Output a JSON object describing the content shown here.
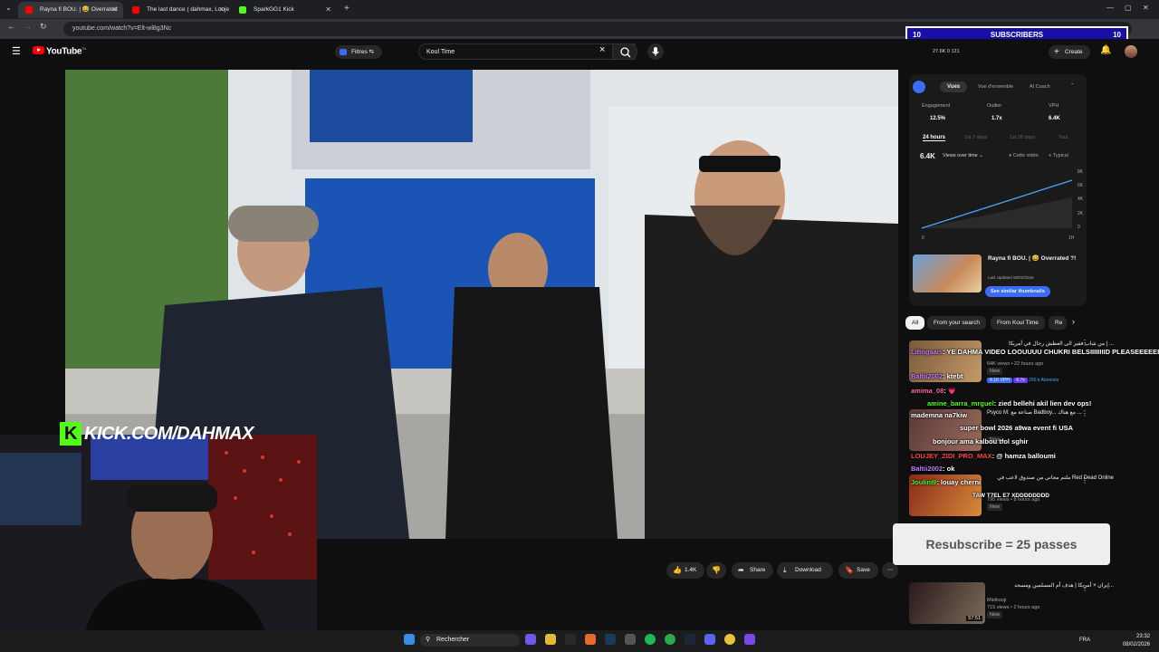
{
  "browser": {
    "tabs": [
      {
        "title": "Rayna fi BOU. | 😅 Overrated",
        "favicon_color": "#ff0000"
      },
      {
        "title": "The last dance ( dahmax, Louje",
        "favicon_color": "#ff0000"
      },
      {
        "title": "SparkGG1 Kick",
        "favicon_color": "#53fc18"
      }
    ],
    "new_tab": "+",
    "url": "youtube.com/watch?v=Elt-wl8g3Nc"
  },
  "youtube": {
    "logo": "YouTube",
    "logo_sup": "TN",
    "filter_label": "Filtres",
    "search_value": "Koul Time",
    "clear_icon": "×",
    "stats": "27.6K  0  121",
    "create_label": "Create"
  },
  "stream": {
    "kick_text": "KICK.COM/DAHMAX",
    "sub_counter": {
      "left": "10",
      "label": "SUBSCRIBERS",
      "right": "10"
    },
    "resub_text": "Resubscribe = 25 passes"
  },
  "actions": {
    "likes": "1.4K",
    "share": "Share",
    "download": "Download",
    "save": "Save"
  },
  "vidiq": {
    "tabs": [
      "Vues",
      "Vue d'ensemble",
      "AI Coach"
    ],
    "metrics": [
      {
        "label": "Engagement",
        "value": "12.5%"
      },
      {
        "label": "Outlier",
        "value": "1.7x"
      },
      {
        "label": "VPH",
        "value": "6.4K"
      }
    ],
    "ranges": [
      "24 hours",
      "1st 7 days",
      "1st 28 days",
      "Tout"
    ],
    "views_value": "6.4K",
    "views_label": "Views over time",
    "legend_this": "Cette vidéo",
    "legend_typical": "Typical",
    "y_ticks": [
      "8K",
      "6K",
      "4K",
      "2K",
      "0"
    ],
    "x_ticks": [
      "0",
      "1H"
    ],
    "video_title": "Rayna fi BOU. | 😅 Overrated ?!",
    "last_updated": "Last Updated 06/02/2026",
    "similar_btn": "See similar thumbnails"
  },
  "filter_chips": [
    "All",
    "From your search",
    "From Koul Time",
    "Re"
  ],
  "recommendations": [
    {
      "title": "من شاب فقير الى العطش رجال في أمريكا | ...",
      "views": "64K views • 22 hours ago",
      "badge": "New",
      "vph": "4.1K VPH",
      "outlier": "6.7x",
      "subs": "256 k Abonnés",
      "color": "#7a5a3a"
    },
    {
      "title": "Psyco M: صناعة مع Badboy... مع هناك ...",
      "views": "",
      "badge": "New",
      "color": "#5a3a3a"
    },
    {
      "title": "ملتم مجاني من صندوق لاعب في Red Dead Online",
      "views": "795 views • 8 hours ago",
      "badge": "New",
      "color": "#8a2a1a"
    },
    {
      "title": "إيران × أمريكا | هدف أم المسلمين ومسجد...",
      "views": "715 views • 2 hours ago",
      "badge": "New",
      "duration": "57:51",
      "channel": "Mistkooji",
      "color": "#7a6a5a"
    }
  ],
  "chat": [
    {
      "user": "Lifingaais",
      "msg": ": YE DAHMA VIDEO LOOUUUU CHUKRI BELSIIIIIIIID PLEASEEEEEE",
      "color": "#c77dff"
    },
    {
      "user": "Baltii2002",
      "msg": ": ktebt",
      "color": "#c77dff"
    },
    {
      "user": "amima_08",
      "msg": ": 💗",
      "color": "#ff6b9d"
    },
    {
      "user": "amine_barra_mrguel",
      "msg": ": zied bellehi akil lien dev ops!",
      "color": "#53fc18"
    },
    {
      "user": "",
      "msg": "mademna na7kiw",
      "color": "#fff"
    },
    {
      "user": "",
      "msg": "super bowl 2026 a9wa event fi USA",
      "color": "#fff"
    },
    {
      "user": "",
      "msg": "bonjour ama kalbou tfol sghir",
      "color": "#fff"
    },
    {
      "user": "LOUJEY_ZIDI_PRO_MAX",
      "msg": ": @ hamza balloumi",
      "color": "#ff4444"
    },
    {
      "user": "Baltii2002",
      "msg": ": ok",
      "color": "#c77dff"
    },
    {
      "user": "Joulini9",
      "msg": ": louay cherni",
      "color": "#53fc18"
    },
    {
      "user": "",
      "msg": "TAW T7EL E7 XDDDDDDDD",
      "color": "#fff"
    }
  ],
  "taskbar": {
    "search": "Rechercher",
    "lang": "FRA",
    "time": "23:32",
    "date": "08/02/2026"
  }
}
